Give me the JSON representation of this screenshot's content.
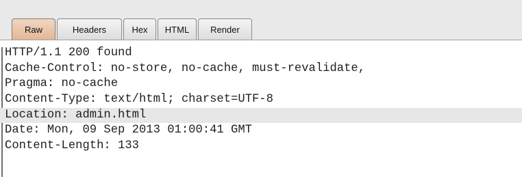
{
  "tabs": [
    {
      "label": "Raw",
      "active": true
    },
    {
      "label": "Headers",
      "active": false
    },
    {
      "label": "Hex",
      "active": false
    },
    {
      "label": "HTML",
      "active": false
    },
    {
      "label": "Render",
      "active": false
    }
  ],
  "response_lines": [
    "HTTP/1.1 200 found",
    "Cache-Control: no-store, no-cache, must-revalidate,",
    "Pragma: no-cache",
    "Content-Type: text/html; charset=UTF-8",
    "Location: admin.html",
    "Date: Mon, 09 Sep 2013 01:00:41 GMT",
    "Content-Length: 133"
  ],
  "colors": {
    "active_tab": "#e3b593",
    "highlight_line": "#e7e7e7"
  }
}
